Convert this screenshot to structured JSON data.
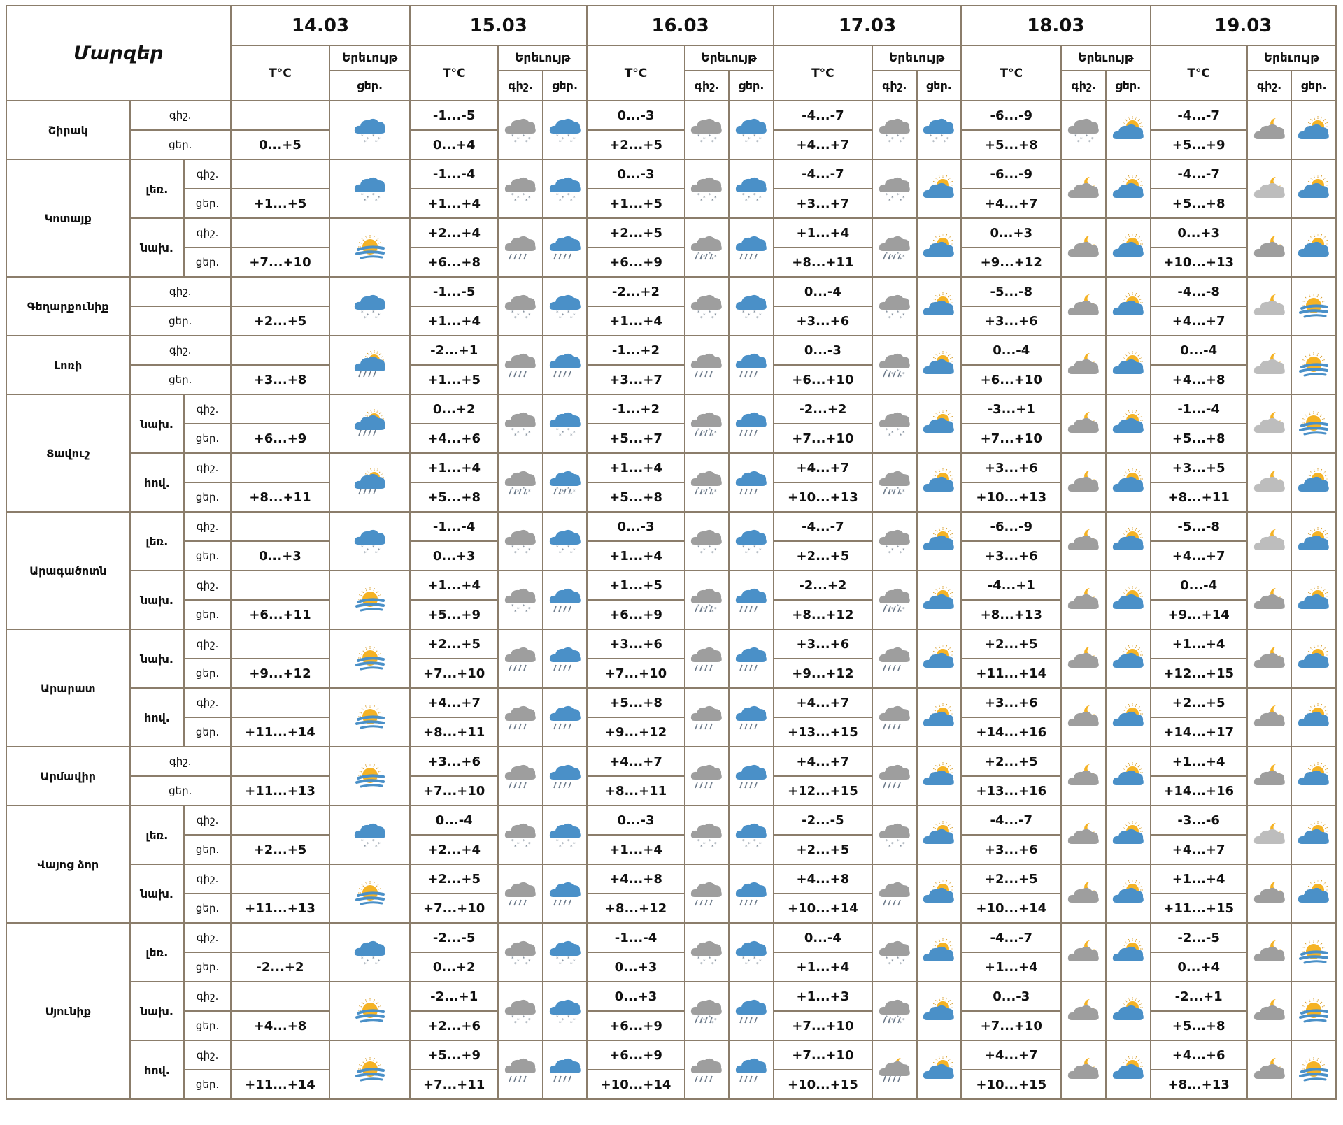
{
  "header": {
    "regions_label": "Մարզեր",
    "temp_label": "T°C",
    "phenomenon_label": "Երեւույթ",
    "night_label": "գիշ.",
    "day_label": "ցեր.",
    "dates": [
      "14.03",
      "15.03",
      "16.03",
      "17.03",
      "18.03",
      "19.03"
    ]
  },
  "colors": {
    "border": "#8b7d6b",
    "cloud_gray": "#9e9e9e",
    "cloud_blue": "#4a90c8",
    "sun": "#f5b325"
  },
  "rows": [
    {
      "region": "Շիրակ",
      "sub": "",
      "period": "գիշ.",
      "first": true,
      "sub_first": true,
      "temps": [
        "",
        "-1...-5",
        "0...-3",
        "-4...-7",
        "-6...-9",
        "-4...-7"
      ],
      "icons": [
        "blue-snow-cloud-icon",
        "gray-snow-cloud-icon",
        "blue-snow-cloud-icon",
        "gray-snow-cloud-icon",
        "blue-snow-cloud-icon",
        "gray-snow-cloud-icon",
        "blue-snow-cloud-icon",
        "gray-snow-cloud-icon",
        "partly-sunny-cloud-icon",
        "gray-moon-cloud-icon",
        "partly-sunny-cloud-icon",
        "light-moon-cloud-icon",
        "partly-sunny-cloud-icon"
      ]
    },
    {
      "region": "",
      "sub": "",
      "period": "ցեր.",
      "temps": [
        "0...+5",
        "0...+4",
        "+2...+5",
        "+4...+7",
        "+5...+8",
        "+5...+9"
      ]
    },
    {
      "region": "Կոտայք",
      "sub": "լեռ.",
      "period": "գիշ.",
      "first": true,
      "sub_first": true,
      "temps": [
        "",
        "-1...-4",
        "0...-3",
        "-4...-7",
        "-6...-9",
        "-4...-7"
      ],
      "icons": [
        "blue-snow-cloud-icon",
        "gray-snow-cloud-icon",
        "blue-snow-cloud-icon",
        "gray-snow-cloud-icon",
        "blue-snow-cloud-icon",
        "gray-snow-cloud-icon",
        "partly-sunny-cloud-icon",
        "gray-moon-cloud-icon",
        "partly-sunny-cloud-icon",
        "light-moon-cloud-icon",
        "partly-sunny-cloud-icon"
      ]
    },
    {
      "region": "",
      "sub": "",
      "period": "ցեր.",
      "temps": [
        "+1...+5",
        "+1...+4",
        "+1...+5",
        "+3...+7",
        "+4...+7",
        "+5...+8"
      ]
    },
    {
      "region": "",
      "sub": "նախ.",
      "period": "գիշ.",
      "sub_first": true,
      "temps": [
        "",
        "+2...+4",
        "+2...+5",
        "+1...+4",
        "0...+3",
        "0...+3"
      ],
      "icons": [
        "sun-fog-icon",
        "gray-rain-cloud-icon",
        "blue-rain-cloud-icon",
        "gray-sleet-cloud-icon",
        "blue-rain-cloud-icon",
        "gray-sleet-cloud-icon",
        "partly-sunny-cloud-icon",
        "gray-moon-cloud-icon",
        "partly-sunny-cloud-icon",
        "gray-moon-cloud-icon",
        "partly-sunny-cloud-icon"
      ]
    },
    {
      "region": "",
      "sub": "",
      "period": "ցեր.",
      "temps": [
        "+7...+10",
        "+6...+8",
        "+6...+9",
        "+8...+11",
        "+9...+12",
        "+10...+13"
      ]
    },
    {
      "region": "Գեղարքունիք",
      "sub": "",
      "period": "գիշ.",
      "first": true,
      "sub_first": true,
      "temps": [
        "",
        "-1...-5",
        "-2...+2",
        "0...-4",
        "-5...-8",
        "-4...-8"
      ],
      "icons": [
        "blue-snow-cloud-icon",
        "gray-snow-cloud-icon",
        "blue-snow-cloud-icon",
        "gray-snow-cloud-icon",
        "blue-snow-cloud-icon",
        "gray-snow-cloud-icon",
        "partly-sunny-cloud-icon",
        "gray-moon-cloud-icon",
        "partly-sunny-cloud-icon",
        "light-moon-cloud-icon",
        "sun-fog-icon"
      ]
    },
    {
      "region": "",
      "sub": "",
      "period": "ցեր.",
      "temps": [
        "+2...+5",
        "+1...+4",
        "+1...+4",
        "+3...+6",
        "+3...+6",
        "+4...+7"
      ]
    },
    {
      "region": "Լոռի",
      "sub": "",
      "period": "գիշ.",
      "first": true,
      "sub_first": true,
      "temps": [
        "",
        "-2...+1",
        "-1...+2",
        "0...-3",
        "0...-4",
        "0...-4"
      ],
      "icons": [
        "sunny-rain-cloud-icon",
        "gray-rain-cloud-icon",
        "blue-rain-cloud-icon",
        "gray-rain-cloud-icon",
        "blue-rain-cloud-icon",
        "gray-sleet-cloud-icon",
        "partly-sunny-cloud-icon",
        "gray-moon-cloud-icon",
        "partly-sunny-cloud-icon",
        "light-moon-cloud-icon",
        "sun-fog-icon"
      ]
    },
    {
      "region": "",
      "sub": "",
      "period": "ցեր.",
      "temps": [
        "+3...+8",
        "+1...+5",
        "+3...+7",
        "+6...+10",
        "+6...+10",
        "+4...+8"
      ]
    },
    {
      "region": "Տավուշ",
      "sub": "նախ.",
      "period": "գիշ.",
      "first": true,
      "sub_first": true,
      "temps": [
        "",
        "0...+2",
        "-1...+2",
        "-2...+2",
        "-3...+1",
        "-1...-4"
      ],
      "icons": [
        "sunny-rain-cloud-icon",
        "gray-snow-cloud-icon",
        "blue-snow-cloud-icon",
        "gray-sleet-cloud-icon",
        "blue-rain-cloud-icon",
        "gray-snow-cloud-icon",
        "partly-sunny-cloud-icon",
        "gray-moon-cloud-icon",
        "partly-sunny-cloud-icon",
        "light-moon-cloud-icon",
        "sun-fog-icon"
      ]
    },
    {
      "region": "",
      "sub": "",
      "period": "ցեր.",
      "temps": [
        "+6...+9",
        "+4...+6",
        "+5...+7",
        "+7...+10",
        "+7...+10",
        "+5...+8"
      ]
    },
    {
      "region": "",
      "sub": "հով.",
      "period": "գիշ.",
      "sub_first": true,
      "temps": [
        "",
        "+1...+4",
        "+1...+4",
        "+4...+7",
        "+3...+6",
        "+3...+5"
      ],
      "icons": [
        "sunny-rain-cloud-icon",
        "gray-sleet-cloud-icon",
        "blue-sleet-cloud-icon",
        "gray-sleet-cloud-icon",
        "blue-rain-cloud-icon",
        "gray-sleet-cloud-icon",
        "partly-sunny-cloud-icon",
        "gray-moon-cloud-icon",
        "partly-sunny-cloud-icon",
        "light-moon-cloud-icon",
        "partly-sunny-cloud-icon"
      ]
    },
    {
      "region": "",
      "sub": "",
      "period": "ցեր.",
      "temps": [
        "+8...+11",
        "+5...+8",
        "+5...+8",
        "+10...+13",
        "+10...+13",
        "+8...+11"
      ]
    },
    {
      "region": "Արագածոտն",
      "sub": "լեռ.",
      "period": "գիշ.",
      "first": true,
      "sub_first": true,
      "temps": [
        "",
        "-1...-4",
        "0...-3",
        "-4...-7",
        "-6...-9",
        "-5...-8"
      ],
      "icons": [
        "blue-snow-cloud-icon",
        "gray-snow-cloud-icon",
        "blue-snow-cloud-icon",
        "gray-snow-cloud-icon",
        "blue-snow-cloud-icon",
        "gray-snow-cloud-icon",
        "partly-sunny-cloud-icon",
        "gray-moon-cloud-icon",
        "partly-sunny-cloud-icon",
        "light-moon-cloud-icon",
        "partly-sunny-cloud-icon"
      ]
    },
    {
      "region": "",
      "sub": "",
      "period": "ցեր.",
      "temps": [
        "0...+3",
        "0...+3",
        "+1...+4",
        "+2...+5",
        "+3...+6",
        "+4...+7"
      ]
    },
    {
      "region": "",
      "sub": "նախ.",
      "period": "գիշ.",
      "sub_first": true,
      "temps": [
        "",
        "+1...+4",
        "+1...+5",
        "-2...+2",
        "-4...+1",
        "0...-4"
      ],
      "icons": [
        "sun-fog-icon",
        "gray-snow-cloud-icon",
        "blue-rain-cloud-icon",
        "gray-sleet-cloud-icon",
        "blue-rain-cloud-icon",
        "gray-sleet-cloud-icon",
        "partly-sunny-cloud-icon",
        "gray-moon-cloud-icon",
        "partly-sunny-cloud-icon",
        "gray-moon-cloud-icon",
        "partly-sunny-cloud-icon"
      ]
    },
    {
      "region": "",
      "sub": "",
      "period": "ցեր.",
      "temps": [
        "+6...+11",
        "+5...+9",
        "+6...+9",
        "+8...+12",
        "+8...+13",
        "+9...+14"
      ]
    },
    {
      "region": "Արարատ",
      "sub": "նախ.",
      "period": "գիշ.",
      "first": true,
      "sub_first": true,
      "temps": [
        "",
        "+2...+5",
        "+3...+6",
        "+3...+6",
        "+2...+5",
        "+1...+4"
      ],
      "icons": [
        "sun-fog-icon",
        "gray-rain-cloud-icon",
        "blue-rain-cloud-icon",
        "gray-rain-cloud-icon",
        "blue-rain-cloud-icon",
        "gray-rain-cloud-icon",
        "partly-sunny-cloud-icon",
        "gray-moon-cloud-icon",
        "partly-sunny-cloud-icon",
        "gray-moon-cloud-icon",
        "partly-sunny-cloud-icon"
      ]
    },
    {
      "region": "",
      "sub": "",
      "period": "ցեր.",
      "temps": [
        "+9...+12",
        "+7...+10",
        "+7...+10",
        "+9...+12",
        "+11...+14",
        "+12...+15"
      ]
    },
    {
      "region": "",
      "sub": "հով.",
      "period": "գիշ.",
      "sub_first": true,
      "temps": [
        "",
        "+4...+7",
        "+5...+8",
        "+4...+7",
        "+3...+6",
        "+2...+5"
      ],
      "icons": [
        "sun-fog-icon",
        "gray-rain-cloud-icon",
        "blue-rain-cloud-icon",
        "gray-rain-cloud-icon",
        "blue-rain-cloud-icon",
        "gray-rain-cloud-icon",
        "partly-sunny-cloud-icon",
        "gray-moon-cloud-icon",
        "partly-sunny-cloud-icon",
        "gray-moon-cloud-icon",
        "partly-sunny-cloud-icon"
      ]
    },
    {
      "region": "",
      "sub": "",
      "period": "ցեր.",
      "temps": [
        "+11...+14",
        "+8...+11",
        "+9...+12",
        "+13...+15",
        "+14...+16",
        "+14...+17"
      ]
    },
    {
      "region": "Արմավիր",
      "sub": "",
      "period": "գիշ.",
      "first": true,
      "sub_first": true,
      "temps": [
        "",
        "+3...+6",
        "+4...+7",
        "+4...+7",
        "+2...+5",
        "+1...+4"
      ],
      "icons": [
        "sun-fog-icon",
        "gray-rain-cloud-icon",
        "blue-rain-cloud-icon",
        "gray-rain-cloud-icon",
        "blue-rain-cloud-icon",
        "gray-rain-cloud-icon",
        "partly-sunny-cloud-icon",
        "gray-moon-cloud-icon",
        "partly-sunny-cloud-icon",
        "gray-moon-cloud-icon",
        "partly-sunny-cloud-icon"
      ]
    },
    {
      "region": "",
      "sub": "",
      "period": "ցեր.",
      "temps": [
        "+11...+13",
        "+7...+10",
        "+8...+11",
        "+12...+15",
        "+13...+16",
        "+14...+16"
      ]
    },
    {
      "region": "Վայոց ձոր",
      "sub": "լեռ.",
      "period": "գիշ.",
      "first": true,
      "sub_first": true,
      "temps": [
        "",
        "0...-4",
        "0...-3",
        "-2...-5",
        "-4...-7",
        "-3...-6"
      ],
      "icons": [
        "blue-snow-cloud-icon",
        "gray-snow-cloud-icon",
        "blue-snow-cloud-icon",
        "gray-snow-cloud-icon",
        "blue-snow-cloud-icon",
        "gray-snow-cloud-icon",
        "partly-sunny-cloud-icon",
        "gray-moon-cloud-icon",
        "partly-sunny-cloud-icon",
        "light-moon-cloud-icon",
        "partly-sunny-cloud-icon"
      ]
    },
    {
      "region": "",
      "sub": "",
      "period": "ցեր.",
      "temps": [
        "+2...+5",
        "+2...+4",
        "+1...+4",
        "+2...+5",
        "+3...+6",
        "+4...+7"
      ]
    },
    {
      "region": "",
      "sub": "նախ.",
      "period": "գիշ.",
      "sub_first": true,
      "temps": [
        "",
        "+2...+5",
        "+4...+8",
        "+4...+8",
        "+2...+5",
        "+1...+4"
      ],
      "icons": [
        "sun-fog-icon",
        "gray-rain-cloud-icon",
        "blue-rain-cloud-icon",
        "gray-rain-cloud-icon",
        "blue-rain-cloud-icon",
        "gray-rain-cloud-icon",
        "partly-sunny-cloud-icon",
        "gray-moon-cloud-icon",
        "partly-sunny-cloud-icon",
        "gray-moon-cloud-icon",
        "partly-sunny-cloud-icon"
      ]
    },
    {
      "region": "",
      "sub": "",
      "period": "ցեր.",
      "temps": [
        "+11...+13",
        "+7...+10",
        "+8...+12",
        "+10...+14",
        "+10...+14",
        "+11...+15"
      ]
    },
    {
      "region": "Սյունիք",
      "sub": "լեռ.",
      "period": "գիշ.",
      "first": true,
      "sub_first": true,
      "temps": [
        "",
        "-2...-5",
        "-1...-4",
        "0...-4",
        "-4...-7",
        "-2...-5"
      ],
      "icons": [
        "blue-snow-cloud-icon",
        "gray-snow-cloud-icon",
        "blue-snow-cloud-icon",
        "gray-snow-cloud-icon",
        "blue-snow-cloud-icon",
        "gray-snow-cloud-icon",
        "partly-sunny-cloud-icon",
        "gray-moon-cloud-icon",
        "partly-sunny-cloud-icon",
        "gray-moon-cloud-icon",
        "sun-fog-icon"
      ]
    },
    {
      "region": "",
      "sub": "",
      "period": "ցեր.",
      "temps": [
        "-2...+2",
        "0...+2",
        "0...+3",
        "+1...+4",
        "+1...+4",
        "0...+4"
      ]
    },
    {
      "region": "",
      "sub": "նախ.",
      "period": "գիշ.",
      "sub_first": true,
      "temps": [
        "",
        "-2...+1",
        "0...+3",
        "+1...+3",
        "0...-3",
        "-2...+1"
      ],
      "icons": [
        "sun-fog-icon",
        "gray-snow-cloud-icon",
        "blue-snow-cloud-icon",
        "gray-sleet-cloud-icon",
        "blue-rain-cloud-icon",
        "gray-sleet-cloud-icon",
        "partly-sunny-cloud-icon",
        "gray-moon-cloud-icon",
        "partly-sunny-cloud-icon",
        "gray-moon-cloud-icon",
        "sun-fog-icon"
      ]
    },
    {
      "region": "",
      "sub": "",
      "period": "ցեր.",
      "temps": [
        "+4...+8",
        "+2...+6",
        "+6...+9",
        "+7...+10",
        "+7...+10",
        "+5...+8"
      ]
    },
    {
      "region": "",
      "sub": "հով.",
      "period": "գիշ.",
      "sub_first": true,
      "temps": [
        "",
        "+5...+9",
        "+6...+9",
        "+7...+10",
        "+4...+7",
        "+4...+6"
      ],
      "icons": [
        "sun-fog-icon",
        "gray-rain-cloud-icon",
        "blue-rain-cloud-icon",
        "gray-rain-cloud-icon",
        "blue-rain-cloud-icon",
        "gray-moon-rain-cloud-icon",
        "partly-sunny-cloud-icon",
        "gray-moon-cloud-icon",
        "partly-sunny-cloud-icon",
        "gray-moon-cloud-icon",
        "sun-fog-icon"
      ]
    },
    {
      "region": "",
      "sub": "",
      "period": "ցեր.",
      "temps": [
        "+11...+14",
        "+7...+11",
        "+10...+14",
        "+10...+15",
        "+10...+15",
        "+8...+13"
      ]
    }
  ]
}
